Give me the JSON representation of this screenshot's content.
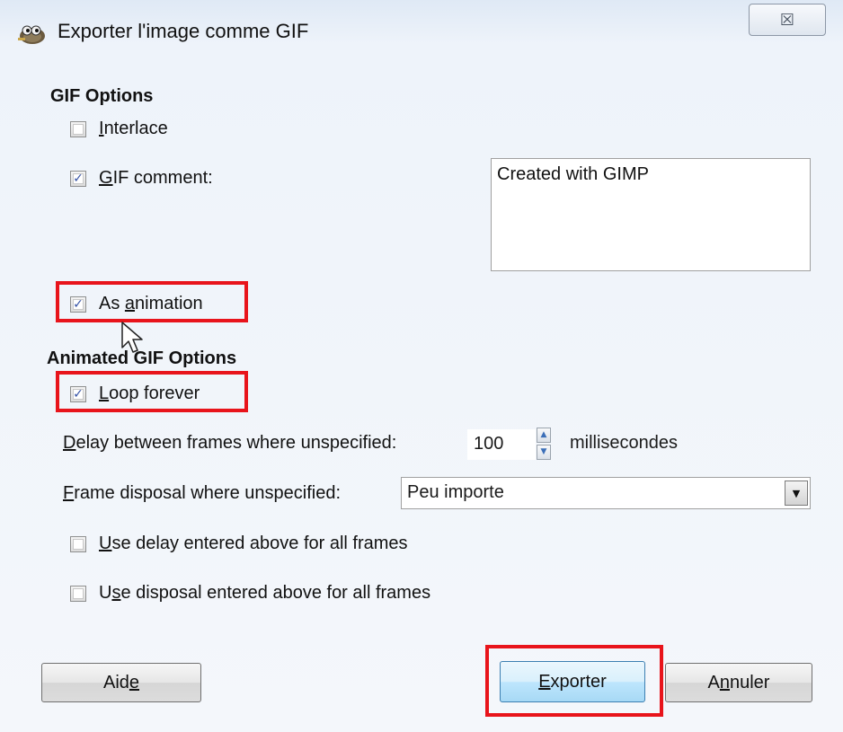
{
  "window": {
    "title": "Exporter l'image comme GIF",
    "close_glyph": "☒",
    "app_icon": "gimp-wilber-icon"
  },
  "gif_options": {
    "heading": "GIF Options",
    "interlace": {
      "label_underlined": "I",
      "label_rest": "nterlace",
      "checked": false
    },
    "gif_comment": {
      "label_underlined": "G",
      "label_rest": "IF comment:",
      "checked": true,
      "value": "Created with GIMP"
    },
    "as_animation": {
      "label_pre": "As ",
      "label_underlined": "a",
      "label_rest": "nimation",
      "checked": true
    }
  },
  "animated_options": {
    "heading": "Animated GIF Options",
    "loop_forever": {
      "label_underlined": "L",
      "label_rest": "oop forever",
      "checked": true
    },
    "delay": {
      "label_underlined": "D",
      "label_rest": "elay between frames where unspecified:",
      "value": "100",
      "units": "millisecondes"
    },
    "disposal": {
      "label_underlined": "F",
      "label_rest": "rame disposal where unspecified:",
      "selected": "Peu importe"
    },
    "use_delay_all": {
      "label_underlined": "U",
      "label_rest": "se delay entered above for all frames",
      "checked": false
    },
    "use_disposal_all": {
      "label_pre": "U",
      "label_underlined": "s",
      "label_rest": "e disposal entered above for all frames",
      "checked": false
    }
  },
  "buttons": {
    "help": {
      "label_pre": "Aid",
      "label_underlined": "e"
    },
    "export": {
      "label_underlined": "E",
      "label_rest": "xporter"
    },
    "cancel": {
      "label_pre": "A",
      "label_underlined": "n",
      "label_rest": "nuler"
    }
  },
  "check_glyph": "✓",
  "spin_up_glyph": "▲",
  "spin_down_glyph": "▼",
  "dropdown_glyph": "▼",
  "colors": {
    "highlight": "#e8141b",
    "default_button_border": "#3c7fb1",
    "checkmark": "#3552a6"
  }
}
